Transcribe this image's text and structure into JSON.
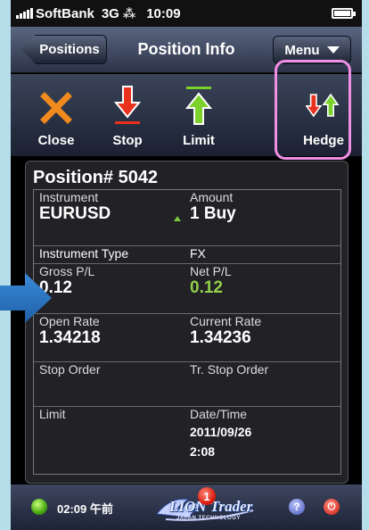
{
  "status_bar": {
    "carrier": "SoftBank",
    "network": "3G",
    "activity": "⁂",
    "time": "10:09"
  },
  "nav": {
    "back_label": "Positions",
    "title": "Position Info",
    "menu_label": "Menu"
  },
  "toolbar": {
    "close_label": "Close",
    "stop_label": "Stop",
    "limit_label": "Limit",
    "hedge_label": "Hedge",
    "colors": {
      "close": "#f08a1c",
      "stop": "#e8321e",
      "limit": "#7cd22a",
      "highlight": "#f08fe3"
    }
  },
  "position": {
    "title": "Position# 5042",
    "instrument_label": "Instrument",
    "instrument": "EURUSD",
    "amount_label": "Amount",
    "amount": "1 Buy",
    "instrument_type_label": "Instrument Type",
    "instrument_type": "FX",
    "gross_pl_label": "Gross P/L",
    "gross_pl": "0.12",
    "net_pl_label": "Net P/L",
    "net_pl": "0.12",
    "open_rate_label": "Open Rate",
    "open_rate": "1.34218",
    "current_rate_label": "Current Rate",
    "current_rate": "1.34236",
    "stop_order_label": "Stop Order",
    "tr_stop_order_label": "Tr. Stop Order",
    "limit_label": "Limit",
    "datetime_label": "Date/Time",
    "date": "2011/09/26",
    "time": "2:08"
  },
  "bottom_bar": {
    "time": "02:09 午前",
    "logo_text": "LION Trader",
    "logo_sub": "JAPAN TECHNOLOGY",
    "badge": "1",
    "help": "?",
    "power": "⏻"
  }
}
